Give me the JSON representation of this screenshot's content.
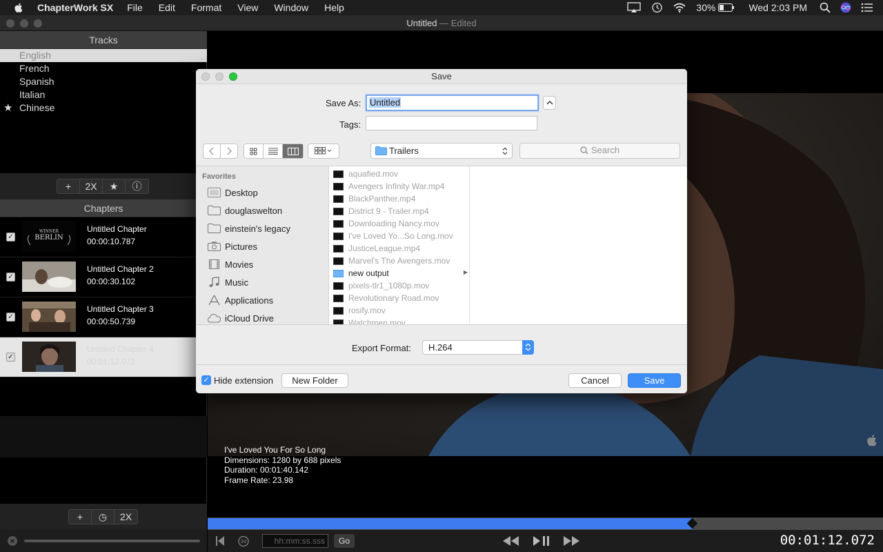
{
  "menubar": {
    "app_name": "ChapterWork SX",
    "menus": [
      "File",
      "Edit",
      "Format",
      "View",
      "Window",
      "Help"
    ],
    "battery": "30%",
    "clock": "Wed 2:03 PM"
  },
  "window": {
    "title": "Untitled",
    "edited": "— Edited"
  },
  "tracks": {
    "header": "Tracks",
    "items": [
      "English",
      "French",
      "Spanish",
      "Italian",
      "Chinese"
    ],
    "toolbar": [
      "+",
      "2X",
      "★",
      "ⓘ"
    ]
  },
  "chapters": {
    "header": "Chapters",
    "items": [
      {
        "title": "Untitled Chapter",
        "time": "00:00:10.787"
      },
      {
        "title": "Untitled Chapter 2",
        "time": "00:00:30.102"
      },
      {
        "title": "Untitled Chapter 3",
        "time": "00:00:50.739"
      },
      {
        "title": "Untitled Chapter 4",
        "time": "00:01:12.072"
      }
    ],
    "toolbar": [
      "+",
      "◷",
      "2X"
    ]
  },
  "video_info": {
    "title": "I've Loved You For So Long",
    "dimensions": "Dimensions: 1280 by 688 pixels",
    "duration": "Duration: 00:01:40.142",
    "frame_rate": "Frame Rate: 23.98"
  },
  "transport": {
    "timecode_placeholder": "hh:mm:ss.sss",
    "go_label": "Go",
    "current_time": "00:01:12.072",
    "progress": 0.718
  },
  "save_dialog": {
    "title": "Save",
    "save_as_label": "Save As:",
    "save_as_value": "Untitled",
    "tags_label": "Tags:",
    "location": "Trailers",
    "search_placeholder": "Search",
    "sidebar_header": "Favorites",
    "sidebar_items": [
      "Desktop",
      "douglaswelton",
      "einstein's legacy",
      "Pictures",
      "Movies",
      "Music",
      "Applications",
      "iCloud Drive"
    ],
    "files": [
      {
        "name": "aquafied.mov",
        "enabled": false
      },
      {
        "name": "Avengers Infinity War.mp4",
        "enabled": false
      },
      {
        "name": "BlackPanther.mp4",
        "enabled": false
      },
      {
        "name": "District 9 - Trailer.mp4",
        "enabled": false
      },
      {
        "name": "Downloading Nancy.mov",
        "enabled": false
      },
      {
        "name": "I've Loved Yo...So Long.mov",
        "enabled": false
      },
      {
        "name": "JusticeLeague.mp4",
        "enabled": false
      },
      {
        "name": "Marvel's The Avengers.mov",
        "enabled": false
      },
      {
        "name": "new output",
        "enabled": true,
        "folder": true
      },
      {
        "name": "pixels-tlr1_1080p.mov",
        "enabled": false
      },
      {
        "name": "Revolutionary Road.mov",
        "enabled": false
      },
      {
        "name": "rosify.mov",
        "enabled": false
      },
      {
        "name": "Watchmen.mov",
        "enabled": false
      }
    ],
    "export_format_label": "Export Format:",
    "export_format_value": "H.264",
    "hide_extension_label": "Hide extension",
    "new_folder_label": "New Folder",
    "cancel_label": "Cancel",
    "save_label": "Save"
  },
  "colors": {
    "accent": "#3d8ef7",
    "timeline_fill": "#3d7bf0"
  }
}
